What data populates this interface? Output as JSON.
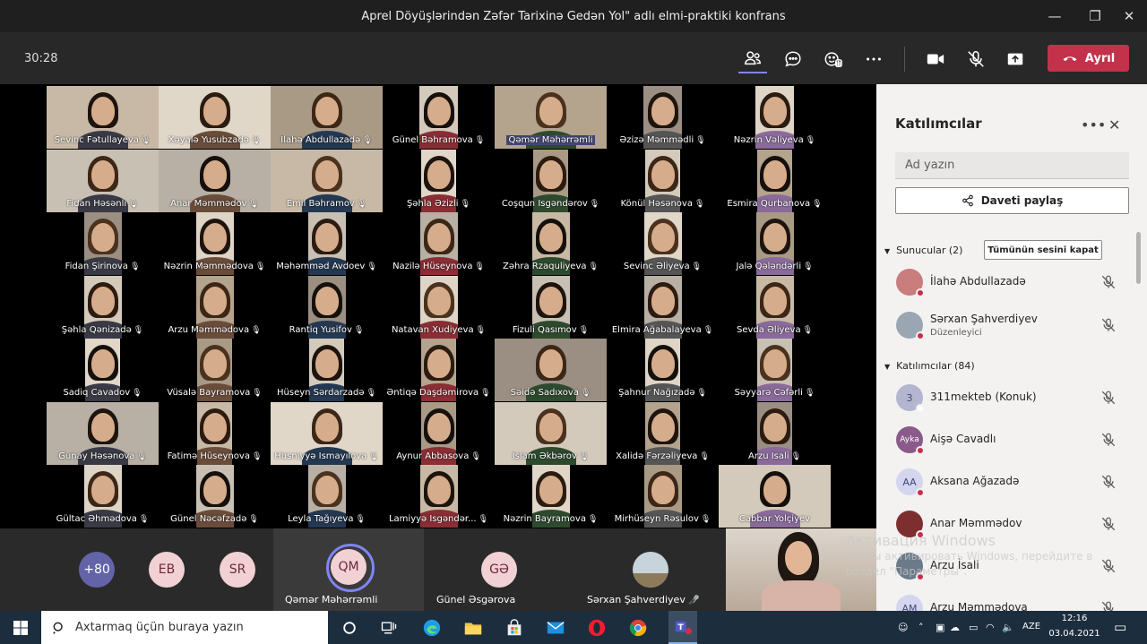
{
  "window": {
    "title": "Aprel Döyüşlərindən Zəfər Tarixinə Gedən Yol\" adlı elmi-praktiki konfrans"
  },
  "toolbar": {
    "timer": "30:28",
    "leave_label": "Ayrıl"
  },
  "gallery": {
    "rows": [
      [
        "Sevinc Fətullayeva",
        "Xəyalə Yusubzadə",
        "İlahə Abdullazadə",
        "Günel Bəhramova",
        "Qəmər Məhərrəmli",
        "Əzizə Məmmədli",
        "Nəzrin Vəliyeva"
      ],
      [
        "Fidan Həsənli",
        "Anar Məmmədov",
        "Emil Bəhramov",
        "Şəhla Əzizli",
        "Coşqun İsgəndərov",
        "Könül Həsənova",
        "Esmira Qurbanova"
      ],
      [
        "Fidan Şirinova",
        "Nəzrin Məmmədova",
        "Məhəmməd Avdoev",
        "Nazilə Hüseynova",
        "Zəhra Rzaquliyeva",
        "Sevinc Əliyeva",
        "Jalə Qələndərli"
      ],
      [
        "Şəhla Qənizadə",
        "Arzu Məmmədova",
        "Rantiq Yusifov",
        "Natavan Xudiyeva",
        "Fizuli Qasımov",
        "Elmira Ağabalayeva",
        "Sevda Əliyeva"
      ],
      [
        "Sadiq Cavadov",
        "Vüsalə Bayramova",
        "Hüseyn Sərdarzadə",
        "Əntiqə Daşdəmirova",
        "Səidə Sadıxova",
        "Şahnur Nağızadə",
        "Səyyarə Cəfərli"
      ],
      [
        "Günay Həsənova",
        "Fatimə Hüseynova",
        "Hüsniyyə İsmayılova",
        "Aynur Abbasova",
        "İslam Əkbərov",
        "Xalidə Fərzəliyeva",
        "Arzu İsali"
      ],
      [
        "Gültac Əhmədova",
        "Günel Nəcəfzadə",
        "Leyla Tağıyeva",
        "Lamiyyə İsgəndər...",
        "Nəzrin Bayramova",
        "Mirhüseyn Rəsulov",
        "Cabbar Yolçiyev"
      ]
    ]
  },
  "strip": {
    "overflow": "+80",
    "eb": "EB",
    "sr": "SR",
    "qm_initials": "QM",
    "qm_name": "Qəmər Məhərrəmli",
    "gə_initials": "GƏ",
    "gə_name": "Günel Əsgərova",
    "sahverdiyev_name": "Sərxan Şahverdiyev"
  },
  "panel": {
    "title": "Katılımcılar",
    "search_placeholder": "Ad yazın",
    "invite_label": "Daveti paylaş",
    "presenters_header": "Sunucular (2)",
    "mute_all_label": "Tümünün sesini kapat",
    "attendees_header": "Katılımcılar (84)",
    "presenters": [
      {
        "name": "İlahə Abdullazadə",
        "role": ""
      },
      {
        "name": "Sərxan Şahverdiyev",
        "role": "Düzenleyici"
      }
    ],
    "attendees": [
      {
        "name": "311mekteb (Konuk)",
        "initials": "3"
      },
      {
        "name": "Aişə Cavadlı",
        "initials": "Ayka"
      },
      {
        "name": "Aksana Ağazadə",
        "initials": "AA"
      },
      {
        "name": "Anar Məmmədov",
        "initials": ""
      },
      {
        "name": "Arzu İsali",
        "initials": ""
      },
      {
        "name": "Arzu Məmmədova",
        "initials": "AM"
      }
    ]
  },
  "watermark": {
    "title": "Активация Windows",
    "text": "Чтобы активировать Windows, перейдите в раздел \"Параметры\"."
  },
  "taskbar": {
    "search_placeholder": "Axtarmaq üçün buraya yazın",
    "lang": "AZE",
    "time": "12:16",
    "date": "03.04.2021"
  },
  "colors": {
    "leave": "#c4314b",
    "accent": "#464775",
    "ring": "#7f85f5",
    "taskbar": "#1c2d3e"
  }
}
